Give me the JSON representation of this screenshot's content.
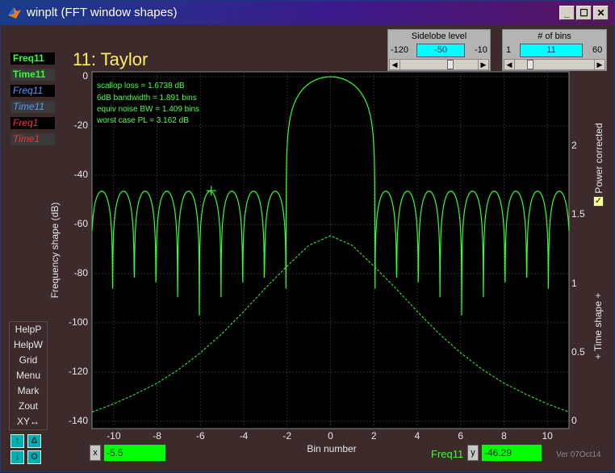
{
  "window": {
    "title": "winplt (FFT window shapes)"
  },
  "titlebar_buttons": {
    "minimize": "_",
    "maximize": "☐",
    "close": "✕"
  },
  "sidelobe_panel": {
    "title": "Sidelobe level",
    "min": "-120",
    "value": "-50",
    "max": "-10",
    "fraction": 0.64
  },
  "bins_panel": {
    "title": "# of bins",
    "min": "1",
    "value": "11",
    "max": "60",
    "fraction": 0.17
  },
  "traces": [
    {
      "label": "Freq11",
      "color": "#33ff33",
      "bg": "#000000",
      "bold": true,
      "italic": false
    },
    {
      "label": "Time11",
      "color": "#33ff33",
      "bg": "#3a3a3a",
      "bold": true,
      "italic": false
    },
    {
      "label": "Freq11",
      "color": "#5599ff",
      "bg": "#000000",
      "bold": false,
      "italic": true
    },
    {
      "label": "Time11",
      "color": "#5599ff",
      "bg": "#3a3a3a",
      "bold": false,
      "italic": true
    },
    {
      "label": "Freq1",
      "color": "#ff3333",
      "bg": "#000000",
      "bold": false,
      "italic": true
    },
    {
      "label": "Time1",
      "color": "#ff3333",
      "bg": "#3a3a3a",
      "bold": false,
      "italic": true
    }
  ],
  "menu": [
    "HelpP",
    "HelpW",
    "Grid",
    "Menu",
    "Mark",
    "Zout",
    "XY↔"
  ],
  "nav_buttons": {
    "up": "↑",
    "delta": "Δ",
    "down": "↓",
    "o": "O"
  },
  "plot_title": "11: Taylor",
  "stats": [
    "scallop loss = 1.6738 dB",
    "6dB bandwidth = 1.891 bins",
    "equiv noise BW = 1.409 bins",
    "worst case PL = 3.162 dB"
  ],
  "y_axis_label": "Frequency shape (dB)",
  "y_ticks": [
    "0",
    "-20",
    "-40",
    "-60",
    "-80",
    "-100",
    "-120",
    "-140"
  ],
  "y2_axis_label": "+ Time shape +",
  "y2_ticks": [
    "2",
    "1.5",
    "1",
    "0.5",
    "0"
  ],
  "x_axis_label": "Bin number",
  "x_ticks": [
    "-10",
    "-8",
    "-6",
    "-4",
    "-2",
    "0",
    "2",
    "4",
    "6",
    "8",
    "10"
  ],
  "power_corrected": {
    "label": "Power corrected",
    "checked": true
  },
  "cursor": {
    "x_label": "x",
    "x_value": "-5.5",
    "trace": "Freq11",
    "y_label": "y",
    "y_value": "-46.29"
  },
  "version": "Ver 07Oct14",
  "chart_data": {
    "type": "line",
    "title": "11: Taylor",
    "xlabel": "Bin number",
    "ylabel": "Frequency shape (dB)",
    "y2label": "+ Time shape +",
    "xlim": [
      -11,
      11
    ],
    "ylim": [
      -143,
      2
    ],
    "y2lim": [
      -0.05,
      2.54
    ],
    "grid": true,
    "series": [
      {
        "name": "Freq11",
        "color": "#33ff33",
        "style": "solid",
        "axis": "left",
        "sidelobe_db": -46.5,
        "mainlobe_halfwidth": 2.05,
        "null_depth_db": -97
      },
      {
        "name": "Time11",
        "color": "#33ff33",
        "style": "dashed",
        "axis": "right",
        "x": [
          -11,
          -10,
          -9,
          -8,
          -7,
          -6,
          -5,
          -4,
          -3,
          -2,
          -1,
          0,
          1,
          2,
          3,
          4,
          5,
          6,
          7,
          8,
          9,
          10,
          11
        ],
        "values": [
          0.07,
          0.13,
          0.2,
          0.28,
          0.38,
          0.5,
          0.64,
          0.8,
          0.97,
          1.13,
          1.28,
          1.35,
          1.28,
          1.13,
          0.97,
          0.8,
          0.64,
          0.5,
          0.38,
          0.28,
          0.2,
          0.13,
          0.07
        ]
      }
    ],
    "marker": {
      "x": -5.5,
      "y": -46.29
    }
  }
}
